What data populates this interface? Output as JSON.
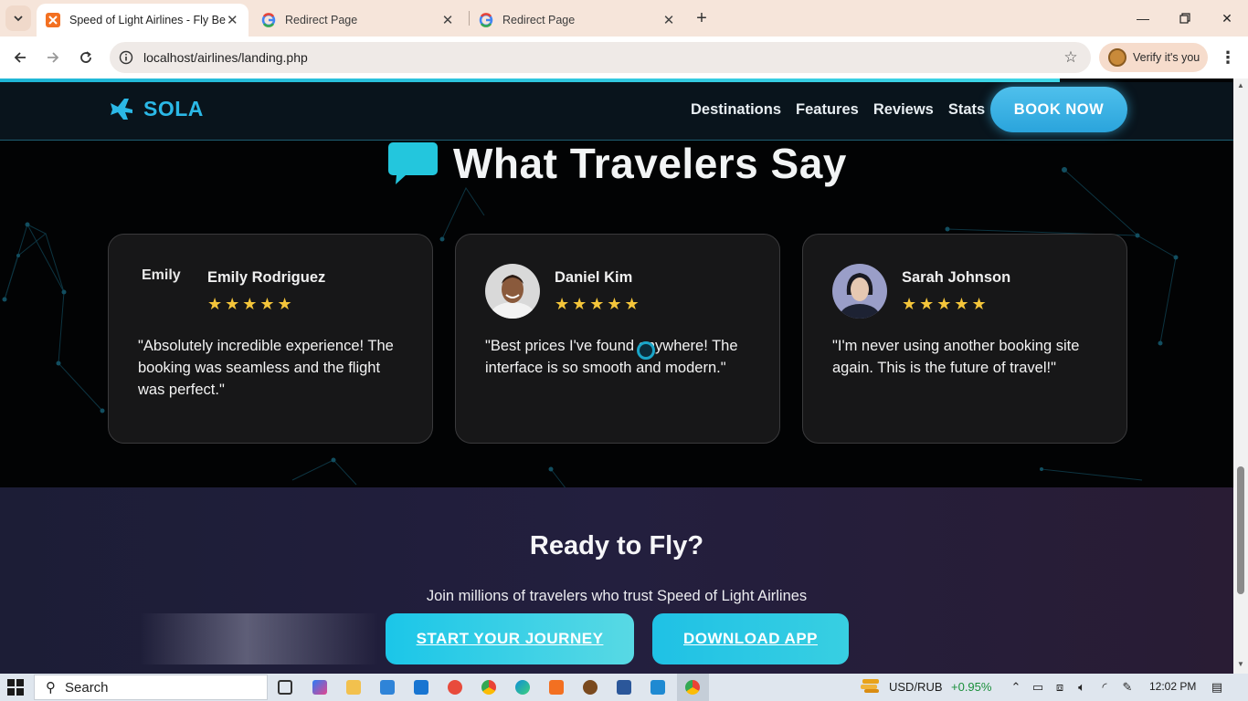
{
  "browser": {
    "tabs": [
      {
        "title": "Speed of Light Airlines - Fly Bey",
        "active": true
      },
      {
        "title": "Redirect Page",
        "active": false
      },
      {
        "title": "Redirect Page",
        "active": false
      }
    ],
    "url": "localhost/airlines/landing.php",
    "verify_label": "Verify it's you"
  },
  "site": {
    "logo_text": "SOLA",
    "nav": [
      "Destinations",
      "Features",
      "Reviews",
      "Stats"
    ],
    "book_label": "BOOK NOW",
    "reviews_title": "What Travelers Say",
    "reviews": [
      {
        "name": "Emily Rodriguez",
        "avatar_alt": "Emily",
        "stars": "★★★★★",
        "rating": 5,
        "quote": "\"Absolutely incredible experience! The booking was seamless and the flight was perfect.\""
      },
      {
        "name": "Daniel Kim",
        "stars": "★★★★★",
        "rating": 5,
        "quote": "\"Best prices I've found anywhere! The interface is so smooth and modern.\""
      },
      {
        "name": "Sarah Johnson",
        "stars": "★★★★★",
        "rating": 5,
        "quote": "\"I'm never using another booking site again. This is the future of travel!\""
      }
    ],
    "cta": {
      "title": "Ready to Fly?",
      "subtitle": "Join millions of travelers who trust Speed of Light Airlines",
      "primary_label": "START YOUR JOURNEY",
      "secondary_label": "DOWNLOAD APP"
    }
  },
  "taskbar": {
    "search_label": "Search",
    "ticker": "USD/RUB",
    "ticker_change": "+0.95%",
    "time": "12:02 PM"
  },
  "colors": {
    "accent": "#2bb8e6",
    "star": "#f4c53a",
    "cta_button": "#1bc6e8",
    "ticker_up": "#1a8f3a"
  },
  "icons": [
    "chevron-down-icon",
    "xampp-favicon-icon",
    "google-favicon-icon",
    "close-icon",
    "new-tab-icon",
    "minimize-icon",
    "restore-icon",
    "back-icon",
    "forward-icon",
    "reload-icon",
    "site-info-icon",
    "bookmark-star-icon",
    "kebab-menu-icon",
    "plane-logo-icon",
    "chat-bubble-icon",
    "windows-start-icon",
    "search-icon"
  ]
}
